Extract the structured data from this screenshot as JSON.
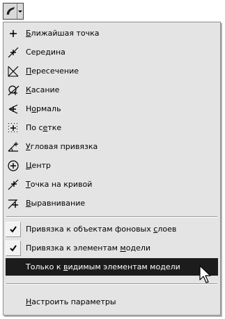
{
  "menu": {
    "items": [
      {
        "pre": "",
        "ul": "Б",
        "post": "лижайшая точка",
        "icon": "nearest-point-icon"
      },
      {
        "pre": "Сере",
        "ul": "д",
        "post": "ина",
        "icon": "midpoint-icon"
      },
      {
        "pre": "",
        "ul": "П",
        "post": "ересечение",
        "icon": "intersection-icon"
      },
      {
        "pre": "",
        "ul": "К",
        "post": "асание",
        "icon": "tangent-icon"
      },
      {
        "pre": "Н",
        "ul": "о",
        "post": "рмаль",
        "icon": "normal-icon"
      },
      {
        "pre": "По с",
        "ul": "е",
        "post": "тке",
        "icon": "grid-icon"
      },
      {
        "pre": "",
        "ul": "У",
        "post": "гловая привязка",
        "icon": "angle-snap-icon"
      },
      {
        "pre": "",
        "ul": "Ц",
        "post": "ентр",
        "icon": "center-icon"
      },
      {
        "pre": "",
        "ul": "Т",
        "post": "очка на кривой",
        "icon": "point-on-curve-icon"
      },
      {
        "pre": "",
        "ul": "В",
        "post": "ыравнивание",
        "icon": "alignment-icon"
      }
    ],
    "options": [
      {
        "pre": "Привязка к объектам фоновых ",
        "ul": "с",
        "post": "лоев",
        "checked": true
      },
      {
        "pre": "Привязка к элементам ",
        "ul": "м",
        "post": "одели",
        "checked": true
      },
      {
        "pre": "Только к ",
        "ul": "в",
        "post": "идимым элементам модели",
        "checked": false
      }
    ],
    "settings": {
      "pre": "",
      "ul": "Н",
      "post": "астроить параметры"
    }
  }
}
